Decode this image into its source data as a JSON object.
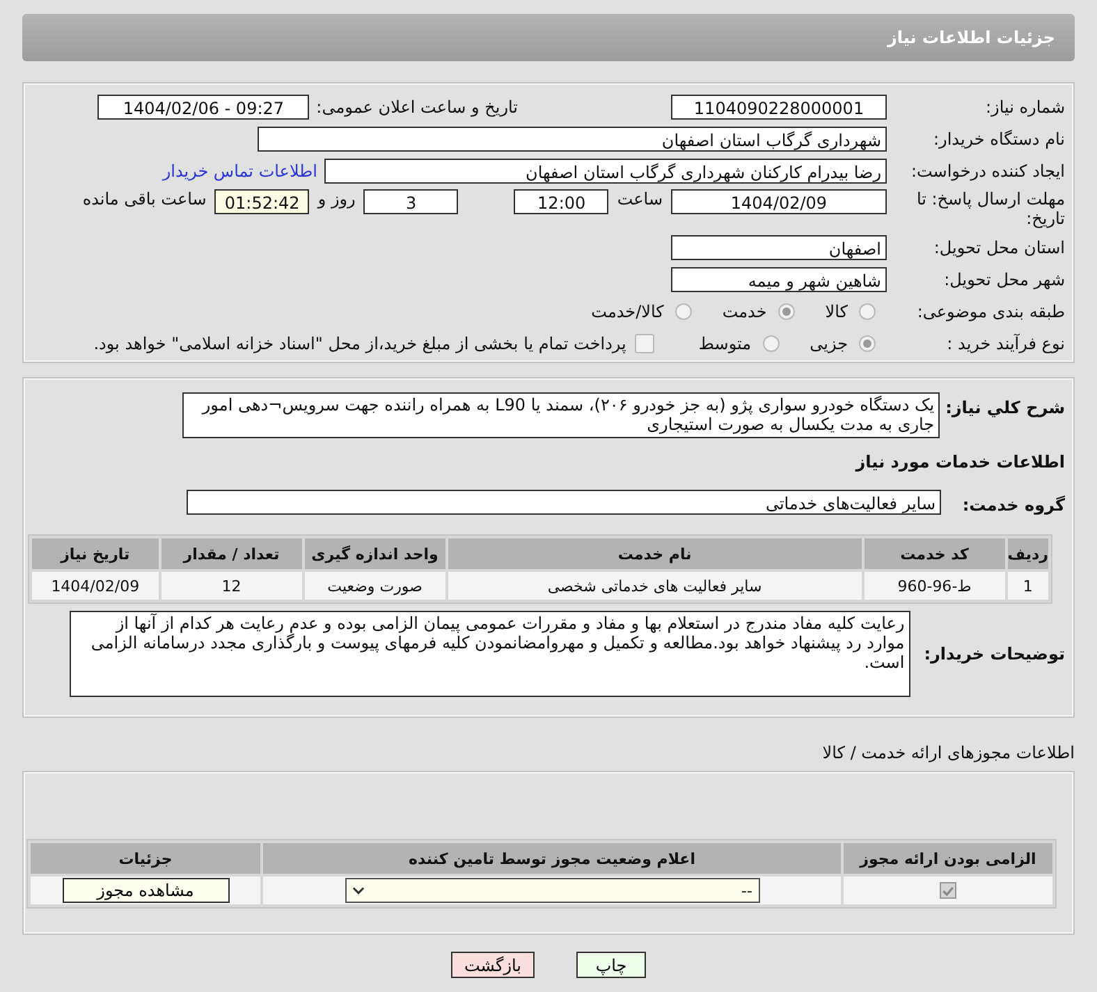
{
  "header": {
    "title": "جزئیات اطلاعات نیاز"
  },
  "need_number": {
    "label": "شماره نیاز:",
    "value": "1104090228000001"
  },
  "announce": {
    "label": "تاریخ و ساعت اعلان عمومی:",
    "value": "1404/02/06 - 09:27"
  },
  "buyer": {
    "label": "نام دستگاه خریدار:",
    "value": "شهرداری گرگاب استان اصفهان"
  },
  "creator": {
    "label": "ایجاد کننده درخواست:",
    "value": "رضا بیدرام کارکنان شهرداری گرگاب استان اصفهان",
    "link": "اطلاعات تماس خریدار"
  },
  "deadline": {
    "label": "مهلت ارسال پاسخ: تا تاریخ:",
    "date": "1404/02/09",
    "time_label": "ساعت",
    "time": "12:00",
    "days": "3",
    "days_label": "روز و",
    "remaining": "01:52:42",
    "remaining_label": "ساعت باقی مانده"
  },
  "province": {
    "label": "استان محل تحویل:",
    "value": "اصفهان"
  },
  "city": {
    "label": "شهر محل تحویل:",
    "value": "شاهین شهر و میمه"
  },
  "classification": {
    "label": "طبقه بندی موضوعی:",
    "options": [
      {
        "label": "کالا",
        "selected": false
      },
      {
        "label": "خدمت",
        "selected": true
      },
      {
        "label": "کالا/خدمت",
        "selected": false
      }
    ]
  },
  "process": {
    "label": "نوع فرآیند خرید :",
    "options": [
      {
        "label": "جزیی",
        "selected": true
      },
      {
        "label": "متوسط",
        "selected": false
      }
    ],
    "treasury": {
      "label": "پرداخت تمام یا بخشی از مبلغ خرید،از محل \"اسناد خزانه اسلامی\" خواهد بود.",
      "checked": false
    }
  },
  "description": {
    "label": "شرح کلي نياز:",
    "value": "یک دستگاه خودرو سواری پژو (به جز خودرو ۲۰۶)، سمند یا L90 به همراه راننده جهت سرویس¬دهی امور جاری به مدت یکسال به صورت استیجاری"
  },
  "services_heading": "اطلاعات خدمات مورد نیاز",
  "service_group": {
    "label": "گروه خدمت:",
    "value": "سایر فعالیت‌های خدماتی"
  },
  "services_table": {
    "columns": [
      "ردیف",
      "کد خدمت",
      "نام خدمت",
      "واحد اندازه گیری",
      "تعداد / مقدار",
      "تاریخ نیاز"
    ],
    "rows": [
      [
        "1",
        "ط-96-960",
        "سایر فعالیت های خدماتی شخصی",
        "صورت وضعیت",
        "12",
        "1404/02/09"
      ]
    ]
  },
  "buyer_notes": {
    "label": "توضیحات خریدار:",
    "value": "رعایت کلیه مفاد مندرج در استعلام بها و مفاد و مقررات عمومی پیمان الزامی بوده و عدم رعایت هر کدام از آنها از موارد رد پیشنهاد خواهد بود.مطالعه و تکمیل و مهروامضانمودن کلیه فرمهای پیوست و بارگذاری مجدد درسامانه الزامی است."
  },
  "permits": {
    "title": "اطلاعات مجوزهای ارائه خدمت / کالا",
    "columns": [
      "الزامی بودن ارائه مجوز",
      "اعلام وضعیت مجوز توسط تامین کننده",
      "جزئیات"
    ],
    "rows": [
      {
        "required": true,
        "status": "--",
        "button": "مشاهده مجوز"
      }
    ]
  },
  "buttons": [
    {
      "label": "چاپ",
      "kind": "print"
    },
    {
      "label": "بازگشت",
      "kind": "back"
    }
  ]
}
